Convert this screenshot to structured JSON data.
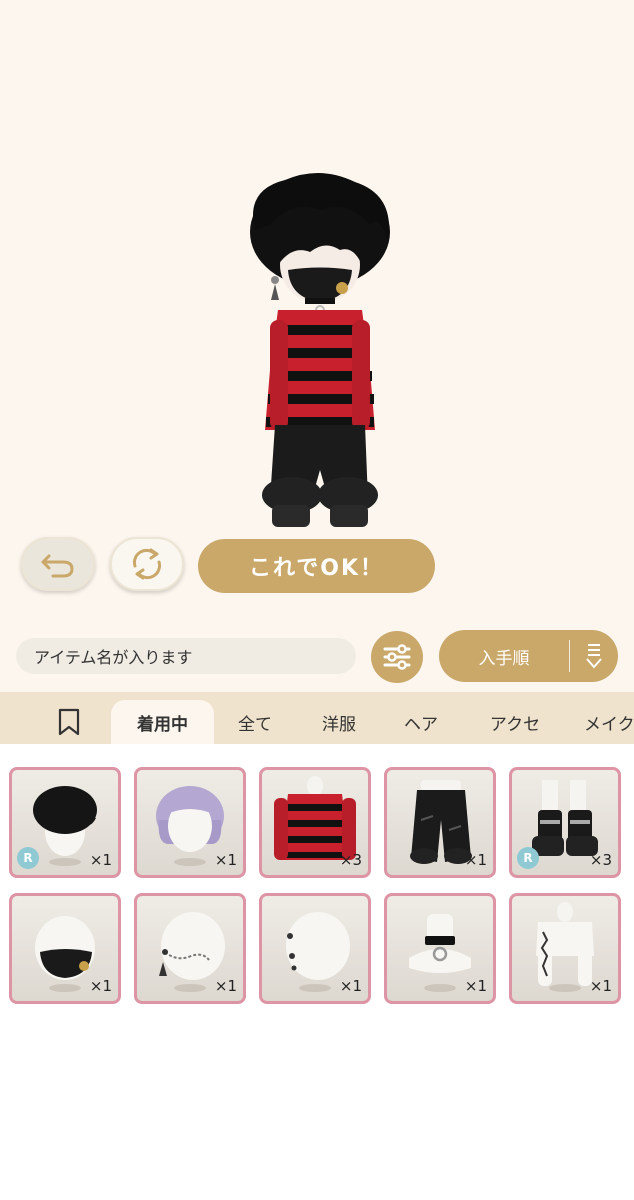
{
  "actions": {
    "ok_label": "これでOK！"
  },
  "search": {
    "placeholder": "アイテム名が入ります"
  },
  "sort": {
    "label": "入手順"
  },
  "tabs": [
    {
      "label": "着用中",
      "active": true
    },
    {
      "label": "全て"
    },
    {
      "label": "洋服"
    },
    {
      "label": "ヘア"
    },
    {
      "label": "アクセ"
    },
    {
      "label": "メイク"
    }
  ],
  "items": [
    {
      "name": "black-messy-hair",
      "count": "×1",
      "rarity": "R"
    },
    {
      "name": "lavender-bob-hair",
      "count": "×1"
    },
    {
      "name": "red-black-striped-sweater",
      "count": "×3"
    },
    {
      "name": "black-ripped-pants",
      "count": "×1"
    },
    {
      "name": "black-platform-boots",
      "count": "×3",
      "rarity": "R"
    },
    {
      "name": "black-mask",
      "count": "×1"
    },
    {
      "name": "chain-earring",
      "count": "×1"
    },
    {
      "name": "stud-earring",
      "count": "×1"
    },
    {
      "name": "black-choker",
      "count": "×1"
    },
    {
      "name": "arm-tattoo",
      "count": "×1"
    }
  ],
  "colors": {
    "gold": "#c9a86a",
    "card_border": "#dd94a4",
    "stage_bg": "#fcf6ee",
    "tab_bg": "#efe3cd"
  }
}
